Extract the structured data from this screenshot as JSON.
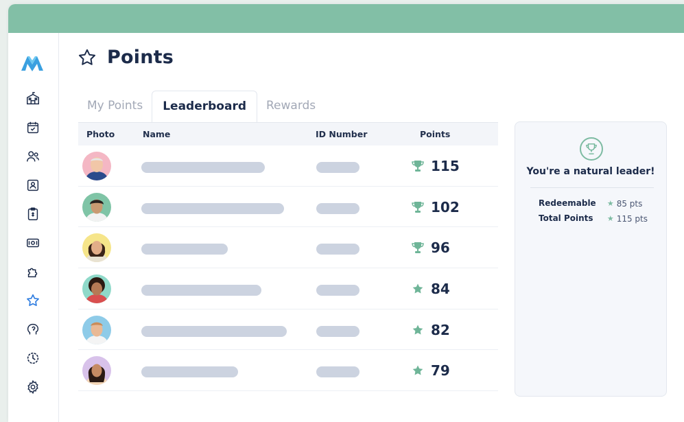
{
  "page": {
    "title": "Points"
  },
  "tabs": [
    {
      "label": "My Points",
      "active": false
    },
    {
      "label": "Leaderboard",
      "active": true
    },
    {
      "label": "Rewards",
      "active": false
    }
  ],
  "table": {
    "headers": {
      "photo": "Photo",
      "name": "Name",
      "id": "ID Number",
      "points": "Points"
    },
    "rows": [
      {
        "points": "115",
        "icon": "trophy-icon"
      },
      {
        "points": "102",
        "icon": "trophy-icon"
      },
      {
        "points": "96",
        "icon": "trophy-icon"
      },
      {
        "points": "84",
        "icon": "star-icon"
      },
      {
        "points": "82",
        "icon": "star-icon"
      },
      {
        "points": "79",
        "icon": "star-icon"
      }
    ]
  },
  "summary": {
    "heading": "You're a natural leader!",
    "redeemable_label": "Redeemable",
    "redeemable_value": "85 pts",
    "total_label": "Total Points",
    "total_value": "115 pts"
  },
  "sidebar": {
    "items": [
      "logo-icon",
      "school-icon",
      "calendar-check-icon",
      "users-icon",
      "id-card-icon",
      "clipboard-icon",
      "money-icon",
      "puzzle-icon",
      "star-icon",
      "brain-icon",
      "progress-icon",
      "settings-icon"
    ]
  },
  "colors": {
    "accent": "#82bfa6",
    "accent_icon": "#6fb598",
    "nav_icon": "#1c2b4a",
    "active_nav": "#2f7de0",
    "placeholder_bar": "#ccd3e0"
  }
}
